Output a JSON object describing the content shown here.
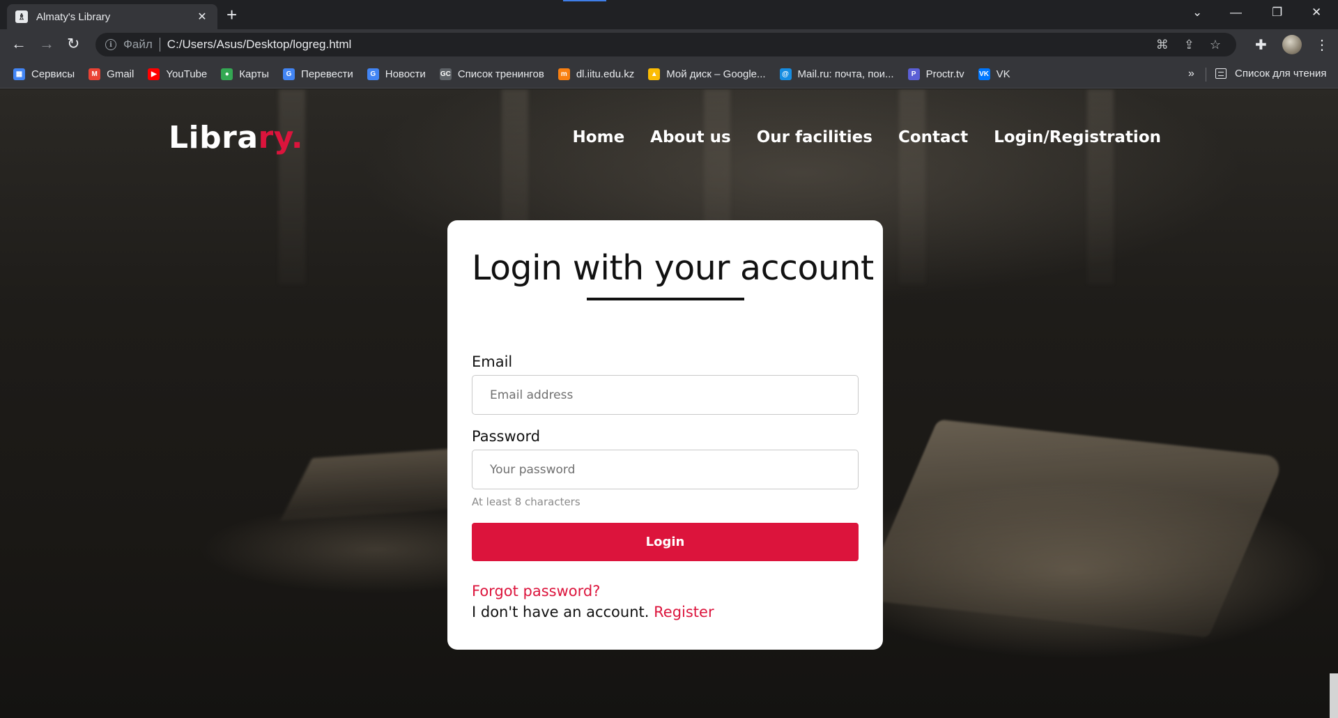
{
  "browser": {
    "tab_title": "Almaty's Library",
    "tab_close": "✕",
    "new_tab": "+",
    "address_scheme": "Файл",
    "address_url": "C:/Users/Asus/Desktop/logreg.html",
    "bookmarks": [
      {
        "label": "Сервисы",
        "icon": "apps-grid-icon",
        "color": "#4285f4"
      },
      {
        "label": "Gmail",
        "icon": "gmail-icon",
        "color": "#ea4335"
      },
      {
        "label": "YouTube",
        "icon": "youtube-icon",
        "color": "#ff0000"
      },
      {
        "label": "Карты",
        "icon": "maps-pin-icon",
        "color": "#34a853"
      },
      {
        "label": "Перевести",
        "icon": "translate-icon",
        "color": "#4285f4"
      },
      {
        "label": "Новости",
        "icon": "news-icon",
        "color": "#4285f4"
      },
      {
        "label": "Список тренингов",
        "icon": "gc-icon",
        "color": "#5f6368"
      },
      {
        "label": "dl.iitu.edu.kz",
        "icon": "moodle-icon",
        "color": "#f98012"
      },
      {
        "label": "Мой диск – Google...",
        "icon": "drive-icon",
        "color": "#fbbc04"
      },
      {
        "label": "Mail.ru: почта, пои...",
        "icon": "mailru-icon",
        "color": "#168de2"
      },
      {
        "label": "Proctr.tv",
        "icon": "proctr-icon",
        "color": "#5b5fd6"
      },
      {
        "label": "VK",
        "icon": "vk-icon",
        "color": "#0077ff"
      }
    ],
    "bookmarks_more": "»",
    "reading_list": "Список для чтения"
  },
  "site": {
    "logo_main": "Libra",
    "logo_accent": "ry.",
    "nav": [
      "Home",
      "About us",
      "Our facilities",
      "Contact",
      "Login/Registration"
    ]
  },
  "login": {
    "title": "Login with your account",
    "email_label": "Email",
    "email_placeholder": "Email address",
    "password_label": "Password",
    "password_placeholder": "Your password",
    "password_hint": "At least 8 characters",
    "submit_label": "Login",
    "forgot_label": "Forgot password?",
    "no_account_text": "I don't have an account.",
    "register_label": "Register"
  },
  "colors": {
    "accent": "#dc143c",
    "chrome_dark": "#202124",
    "chrome_toolbar": "#35363a"
  }
}
